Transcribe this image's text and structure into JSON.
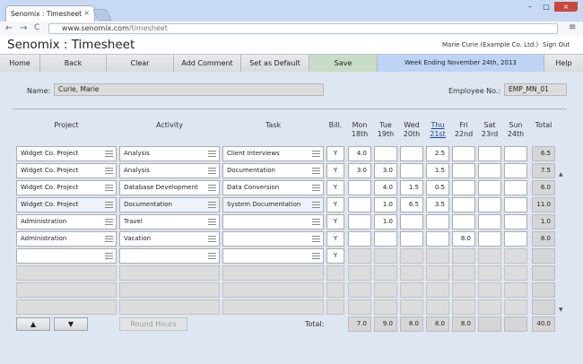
{
  "browser": {
    "tab_title": "Senomix : Timesheet",
    "tab_close": "×",
    "url_host": "www.senomix.com",
    "url_path": "/timesheet",
    "back": "←",
    "forward": "→",
    "reload": "C",
    "menu": "≡",
    "minimize": "–",
    "maximize": "□",
    "close": "×"
  },
  "header": {
    "title": "Senomix : Timesheet",
    "user": "Marie Curie  (Example Co. Ltd.)",
    "sign_out": "Sign Out"
  },
  "toolbar": {
    "home": "Home",
    "back": "Back",
    "clear": "Clear",
    "add_comment": "Add Comment",
    "set_default": "Set as Default",
    "save": "Save",
    "week": "Week Ending November 24th, 2013",
    "help": "Help"
  },
  "form": {
    "name_label": "Name:",
    "name_value": "Curie, Marie",
    "emp_label": "Employee No.:",
    "emp_value": "EMP_MN_01"
  },
  "columns": {
    "project": "Project",
    "activity": "Activity",
    "task": "Task",
    "bill": "Bill.",
    "total": "Total",
    "days": [
      {
        "d": "Mon",
        "n": "18th"
      },
      {
        "d": "Tue",
        "n": "19th"
      },
      {
        "d": "Wed",
        "n": "20th"
      },
      {
        "d": "Thu",
        "n": "21st"
      },
      {
        "d": "Fri",
        "n": "22nd"
      },
      {
        "d": "Sat",
        "n": "23rd"
      },
      {
        "d": "Sun",
        "n": "24th"
      }
    ]
  },
  "rows": [
    {
      "project": "Widget Co. Project",
      "activity": "Analysis",
      "task": "Client Interviews",
      "bill": "Y",
      "hours": [
        "4.0",
        "",
        "",
        "2.5",
        "",
        "",
        ""
      ],
      "total": "6.5"
    },
    {
      "project": "Widget Co. Project",
      "activity": "Analysis",
      "task": "Documentation",
      "bill": "Y",
      "hours": [
        "3.0",
        "3.0",
        "",
        "1.5",
        "",
        "",
        ""
      ],
      "total": "7.5"
    },
    {
      "project": "Widget Co. Project",
      "activity": "Database Development",
      "task": "Data Conversion",
      "bill": "Y",
      "hours": [
        "",
        "4.0",
        "1.5",
        "0.5",
        "",
        "",
        ""
      ],
      "total": "6.0"
    },
    {
      "project": "Widget Co. Project",
      "activity": "Documentation",
      "task": "System Documentation",
      "bill": "Y",
      "hours": [
        "",
        "1.0",
        "6.5",
        "3.5",
        "",
        "",
        ""
      ],
      "total": "11.0"
    },
    {
      "project": "Administration",
      "activity": "Travel",
      "task": "",
      "bill": "Y",
      "hours": [
        "",
        "1.0",
        "",
        "",
        "",
        "",
        ""
      ],
      "total": "1.0"
    },
    {
      "project": "Administration",
      "activity": "Vacation",
      "task": "",
      "bill": "Y",
      "hours": [
        "",
        "",
        "",
        "",
        "8.0",
        "",
        ""
      ],
      "total": "8.0"
    },
    {
      "project": "",
      "activity": "",
      "task": "",
      "bill": "Y",
      "hours": [
        "",
        "",
        "",
        "",
        "",
        "",
        ""
      ],
      "total": ""
    }
  ],
  "totals": {
    "label": "Total:",
    "days": [
      "7.0",
      "9.0",
      "8.0",
      "8.0",
      "8.0",
      "",
      ""
    ],
    "grand": "40.0"
  },
  "buttons": {
    "up": "▲",
    "down": "▼",
    "round": "Round Hours"
  },
  "scrollbar": {
    "up": "▲",
    "down": "▼"
  }
}
